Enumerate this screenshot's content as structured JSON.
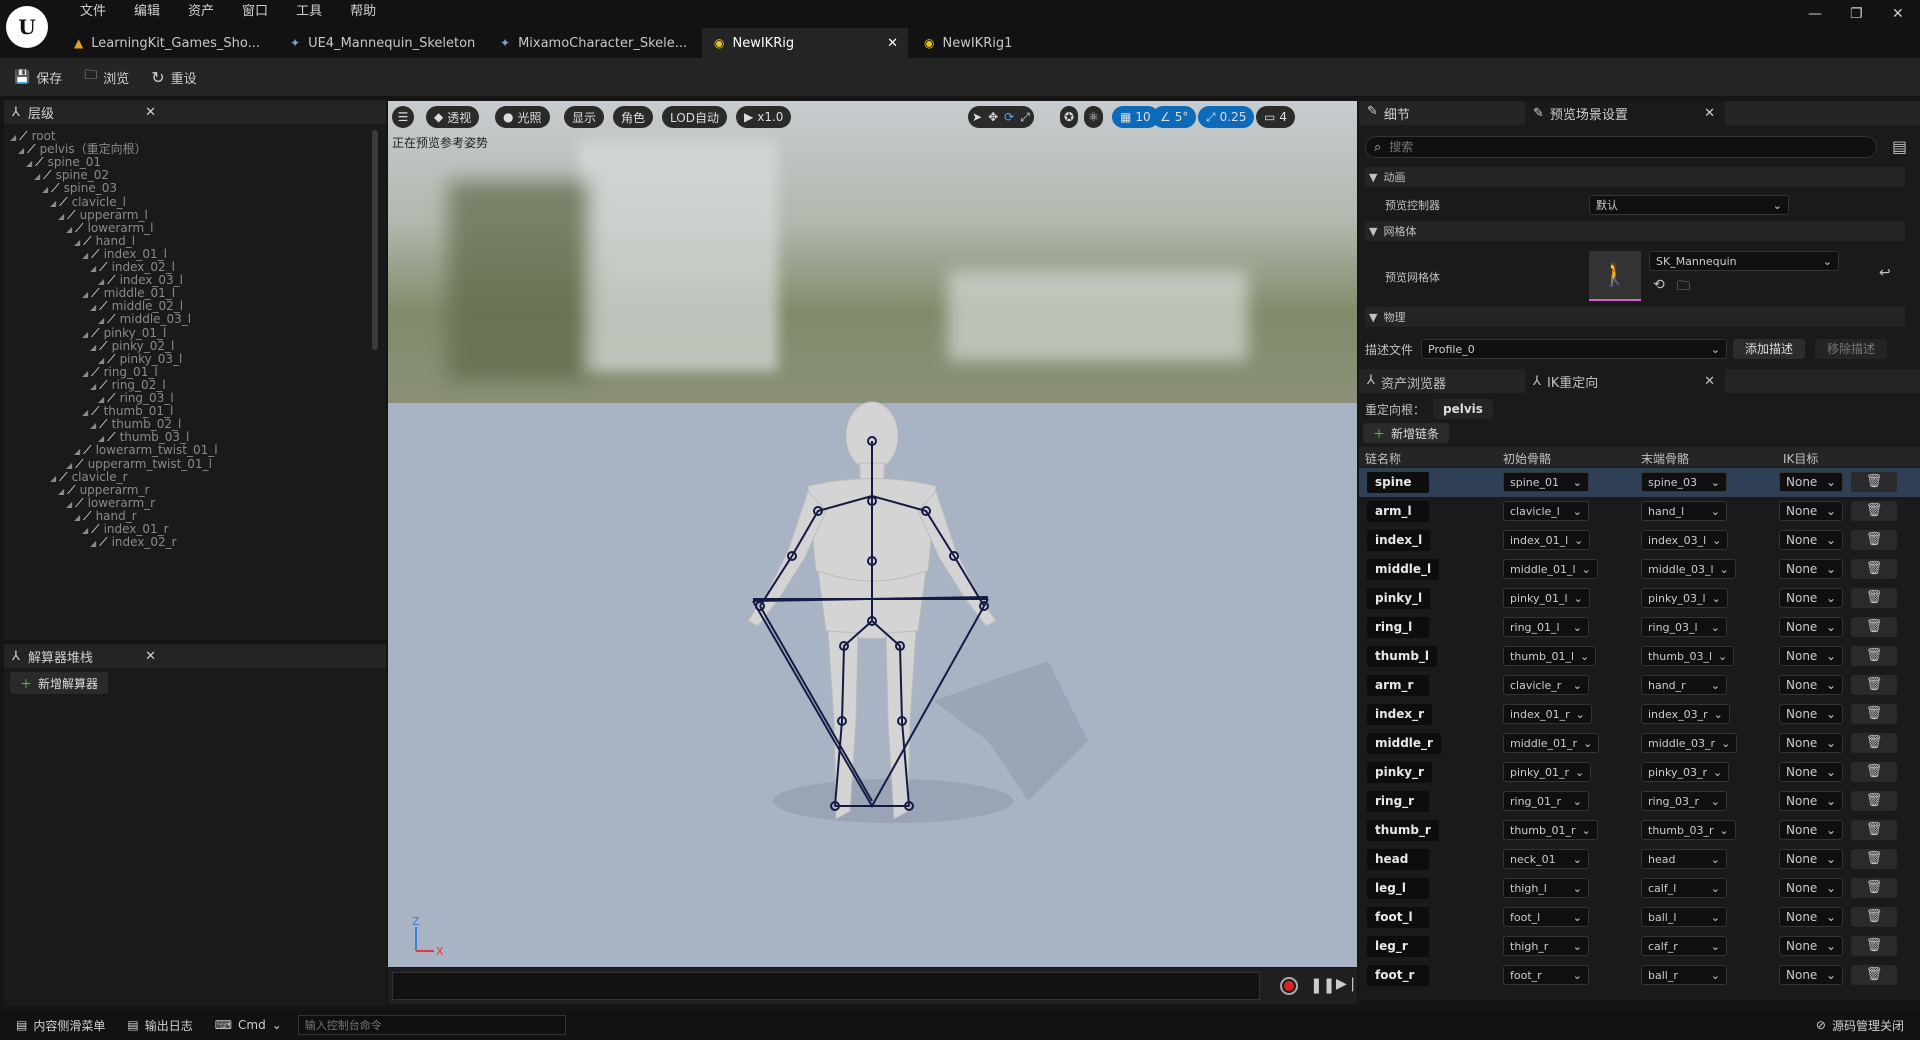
{
  "menu": [
    "文件",
    "编辑",
    "资产",
    "窗口",
    "工具",
    "帮助"
  ],
  "tabs": [
    {
      "label": "LearningKit_Games_Sho...",
      "icon": "warning-icon"
    },
    {
      "label": "UE4_Mannequin_Skeleton",
      "icon": "skeleton-icon"
    },
    {
      "label": "MixamoCharacter_Skele...",
      "icon": "skeleton-icon"
    },
    {
      "label": "NewIKRig",
      "icon": "ikrig-icon",
      "active": true
    },
    {
      "label": "NewIKRig1",
      "icon": "ikrig-icon"
    }
  ],
  "toolbar": {
    "save": "保存",
    "browse": "浏览",
    "reset": "重设"
  },
  "hierarchy": {
    "title": "层级",
    "items": [
      {
        "label": "root",
        "d": 0
      },
      {
        "label": "pelvis（重定向根）",
        "d": 1
      },
      {
        "label": "spine_01",
        "d": 2
      },
      {
        "label": "spine_02",
        "d": 3
      },
      {
        "label": "spine_03",
        "d": 4
      },
      {
        "label": "clavicle_l",
        "d": 5
      },
      {
        "label": "upperarm_l",
        "d": 6
      },
      {
        "label": "lowerarm_l",
        "d": 7
      },
      {
        "label": "hand_l",
        "d": 8
      },
      {
        "label": "index_01_l",
        "d": 9
      },
      {
        "label": "index_02_l",
        "d": 10
      },
      {
        "label": "index_03_l",
        "d": 11
      },
      {
        "label": "middle_01_l",
        "d": 9
      },
      {
        "label": "middle_02_l",
        "d": 10
      },
      {
        "label": "middle_03_l",
        "d": 11
      },
      {
        "label": "pinky_01_l",
        "d": 9
      },
      {
        "label": "pinky_02_l",
        "d": 10
      },
      {
        "label": "pinky_03_l",
        "d": 11
      },
      {
        "label": "ring_01_l",
        "d": 9
      },
      {
        "label": "ring_02_l",
        "d": 10
      },
      {
        "label": "ring_03_l",
        "d": 11
      },
      {
        "label": "thumb_01_l",
        "d": 9
      },
      {
        "label": "thumb_02_l",
        "d": 10
      },
      {
        "label": "thumb_03_l",
        "d": 11
      },
      {
        "label": "lowerarm_twist_01_l",
        "d": 8
      },
      {
        "label": "upperarm_twist_01_l",
        "d": 7
      },
      {
        "label": "clavicle_r",
        "d": 5
      },
      {
        "label": "upperarm_r",
        "d": 6
      },
      {
        "label": "lowerarm_r",
        "d": 7
      },
      {
        "label": "hand_r",
        "d": 8
      },
      {
        "label": "index_01_r",
        "d": 9
      },
      {
        "label": "index_02_r",
        "d": 10
      }
    ]
  },
  "solver": {
    "title": "解算器堆栈",
    "add": "新增解算器"
  },
  "viewport": {
    "menu_icon": "hamburger-icon",
    "perspective": "透视",
    "lit": "光照",
    "show": "显示",
    "character": "角色",
    "lod": "LOD自动",
    "speed": "x1.0",
    "grid": "10",
    "angle": "5°",
    "scale": "0.25",
    "cam": "4",
    "overlay": "正在预览参考姿势",
    "axis_z": "Z",
    "axis_x": "X"
  },
  "details": {
    "tab1": "细节",
    "tab2": "预览场景设置",
    "search_placeholder": "搜索",
    "sec_anim": "动画",
    "preview_controller_label": "预览控制器",
    "preview_controller_value": "默认",
    "sec_mesh": "网格体",
    "preview_mesh_label": "预览网格体",
    "preview_mesh_value": "SK_Mannequin",
    "sec_physics": "物理",
    "profile_label": "描述文件",
    "profile_value": "Profile_0",
    "add_profile": "添加描述",
    "remove_profile": "移除描述"
  },
  "ik": {
    "tab1": "资产浏览器",
    "tab2": "IK重定向",
    "root_label": "重定向根：",
    "root_value": "pelvis",
    "new_chain": "新增链条",
    "headers": [
      "链名称",
      "初始骨骼",
      "末端骨骼",
      "IK目标"
    ],
    "chains": [
      {
        "name": "spine",
        "start": "spine_01",
        "end": "spine_03",
        "goal": "None"
      },
      {
        "name": "arm_l",
        "start": "clavicle_l",
        "end": "hand_l",
        "goal": "None"
      },
      {
        "name": "index_l",
        "start": "index_01_l",
        "end": "index_03_l",
        "goal": "None"
      },
      {
        "name": "middle_l",
        "start": "middle_01_l",
        "end": "middle_03_l",
        "goal": "None"
      },
      {
        "name": "pinky_l",
        "start": "pinky_01_l",
        "end": "pinky_03_l",
        "goal": "None"
      },
      {
        "name": "ring_l",
        "start": "ring_01_l",
        "end": "ring_03_l",
        "goal": "None"
      },
      {
        "name": "thumb_l",
        "start": "thumb_01_l",
        "end": "thumb_03_l",
        "goal": "None"
      },
      {
        "name": "arm_r",
        "start": "clavicle_r",
        "end": "hand_r",
        "goal": "None"
      },
      {
        "name": "index_r",
        "start": "index_01_r",
        "end": "index_03_r",
        "goal": "None"
      },
      {
        "name": "middle_r",
        "start": "middle_01_r",
        "end": "middle_03_r",
        "goal": "None"
      },
      {
        "name": "pinky_r",
        "start": "pinky_01_r",
        "end": "pinky_03_r",
        "goal": "None"
      },
      {
        "name": "ring_r",
        "start": "ring_01_r",
        "end": "ring_03_r",
        "goal": "None"
      },
      {
        "name": "thumb_r",
        "start": "thumb_01_r",
        "end": "thumb_03_r",
        "goal": "None"
      },
      {
        "name": "head",
        "start": "neck_01",
        "end": "head",
        "goal": "None"
      },
      {
        "name": "leg_l",
        "start": "thigh_l",
        "end": "calf_l",
        "goal": "None"
      },
      {
        "name": "foot_l",
        "start": "foot_l",
        "end": "ball_l",
        "goal": "None"
      },
      {
        "name": "leg_r",
        "start": "thigh_r",
        "end": "calf_r",
        "goal": "None"
      },
      {
        "name": "foot_r",
        "start": "foot_r",
        "end": "ball_r",
        "goal": "None"
      }
    ]
  },
  "status": {
    "drawer": "内容侧滑菜单",
    "log": "输出日志",
    "cmd": "Cmd",
    "console_placeholder": "输入控制台命令",
    "source": "源码管理关闭"
  },
  "colors": {
    "accent": "#0d6ab8",
    "selected_row": "#2f3f55"
  }
}
